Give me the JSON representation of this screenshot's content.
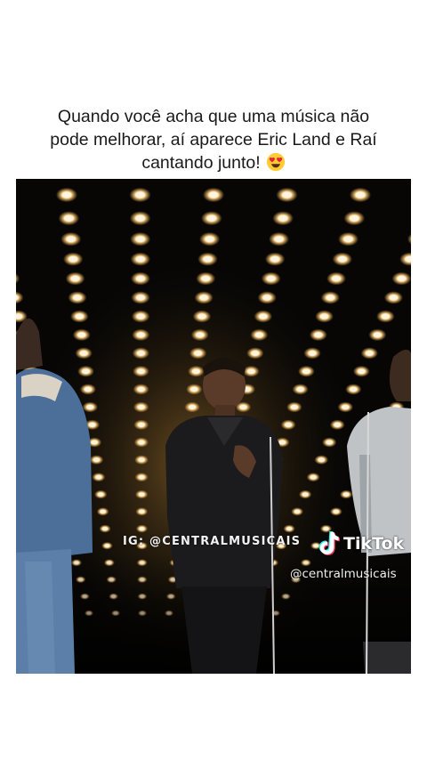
{
  "post": {
    "caption_lines": [
      "Quando você acha que uma música não",
      "pode melhorar, aí aparece Eric Land e Raí",
      "cantando junto!"
    ],
    "caption_emoji": "heart-eyes-emoji"
  },
  "video": {
    "watermark_ig": "IG: @CENTRALMUSICAIS",
    "tiktok_label": "TikTok",
    "tiktok_handle": "@centralmusicais",
    "tiktok_icon": "tiktok-logo-icon"
  },
  "colors": {
    "background": "#ffffff",
    "caption_text": "#1a1a1a",
    "stage_dark": "#070605",
    "stage_light": "#ffe7b8"
  }
}
